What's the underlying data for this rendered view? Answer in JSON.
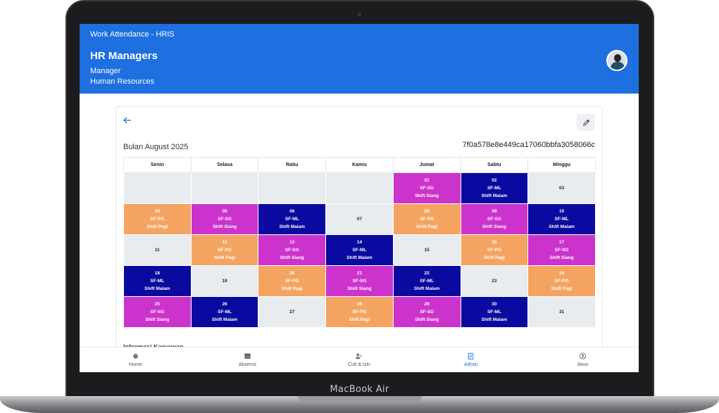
{
  "device": {
    "brand": "MacBook Air"
  },
  "header": {
    "app_title": "Work Attendance - HRIS",
    "user_name": "HR Managers",
    "user_role": "Manager",
    "user_department": "Human Resources"
  },
  "schedule": {
    "month_label": "Bulan August 2025",
    "schedule_id": "7f0a578e8e449ca17060bbfa3058066c",
    "weekdays": [
      "Senin",
      "Selasa",
      "Rabu",
      "Kamis",
      "Jumat",
      "Sabtu",
      "Minggu"
    ],
    "weeks": [
      [
        {
          "day": "",
          "code": "",
          "shift": "",
          "type": "empty"
        },
        {
          "day": "",
          "code": "",
          "shift": "",
          "type": "empty"
        },
        {
          "day": "",
          "code": "",
          "shift": "",
          "type": "empty"
        },
        {
          "day": "",
          "code": "",
          "shift": "",
          "type": "empty"
        },
        {
          "day": "01",
          "code": "SF-SG",
          "shift": "Shift Siang",
          "type": "sg"
        },
        {
          "day": "02",
          "code": "SF-ML",
          "shift": "Shift Malam",
          "type": "ml"
        },
        {
          "day": "03",
          "code": "",
          "shift": "",
          "type": "off"
        }
      ],
      [
        {
          "day": "04",
          "code": "SF-PG",
          "shift": "Shift Pagi",
          "type": "pg"
        },
        {
          "day": "05",
          "code": "SF-SG",
          "shift": "Shift Siang",
          "type": "sg"
        },
        {
          "day": "06",
          "code": "SF-ML",
          "shift": "Shift Malam",
          "type": "ml"
        },
        {
          "day": "07",
          "code": "",
          "shift": "",
          "type": "off"
        },
        {
          "day": "08",
          "code": "SF-PG",
          "shift": "Shift Pagi",
          "type": "pg"
        },
        {
          "day": "09",
          "code": "SF-SG",
          "shift": "Shift Siang",
          "type": "sg"
        },
        {
          "day": "10",
          "code": "SF-ML",
          "shift": "Shift Malam",
          "type": "ml"
        }
      ],
      [
        {
          "day": "11",
          "code": "",
          "shift": "",
          "type": "off"
        },
        {
          "day": "12",
          "code": "SF-PG",
          "shift": "Shift Pagi",
          "type": "pg"
        },
        {
          "day": "13",
          "code": "SF-SG",
          "shift": "Shift Siang",
          "type": "sg"
        },
        {
          "day": "14",
          "code": "SF-ML",
          "shift": "Shift Malam",
          "type": "ml"
        },
        {
          "day": "15",
          "code": "",
          "shift": "",
          "type": "off"
        },
        {
          "day": "16",
          "code": "SF-PG",
          "shift": "Shift Pagi",
          "type": "pg"
        },
        {
          "day": "17",
          "code": "SF-SG",
          "shift": "Shift Siang",
          "type": "sg"
        }
      ],
      [
        {
          "day": "18",
          "code": "SF-ML",
          "shift": "Shift Malam",
          "type": "ml"
        },
        {
          "day": "19",
          "code": "",
          "shift": "",
          "type": "off"
        },
        {
          "day": "20",
          "code": "SF-PG",
          "shift": "Shift Pagi",
          "type": "pg"
        },
        {
          "day": "21",
          "code": "SF-SG",
          "shift": "Shift Siang",
          "type": "sg"
        },
        {
          "day": "22",
          "code": "SF-ML",
          "shift": "Shift Malam",
          "type": "ml"
        },
        {
          "day": "23",
          "code": "",
          "shift": "",
          "type": "off"
        },
        {
          "day": "24",
          "code": "SF-PG",
          "shift": "Shift Pagi",
          "type": "pg"
        }
      ],
      [
        {
          "day": "25",
          "code": "SF-SG",
          "shift": "Shift Siang",
          "type": "sg"
        },
        {
          "day": "26",
          "code": "SF-ML",
          "shift": "Shift Malam",
          "type": "ml"
        },
        {
          "day": "27",
          "code": "",
          "shift": "",
          "type": "off"
        },
        {
          "day": "28",
          "code": "SF-PG",
          "shift": "Shift Pagi",
          "type": "pg"
        },
        {
          "day": "29",
          "code": "SF-SG",
          "shift": "Shift Siang",
          "type": "sg"
        },
        {
          "day": "30",
          "code": "SF-ML",
          "shift": "Shift Malam",
          "type": "ml"
        },
        {
          "day": "31",
          "code": "",
          "shift": "",
          "type": "off"
        }
      ]
    ],
    "cut_off_text": "Informasi Karyawan"
  },
  "nav": {
    "items": [
      {
        "label": "Home",
        "icon": "home-icon",
        "active": false
      },
      {
        "label": "Absensi",
        "icon": "calendar-icon",
        "active": false
      },
      {
        "label": "Cuti & Izin",
        "icon": "user-check-icon",
        "active": false
      },
      {
        "label": "Admin",
        "icon": "clipboard-icon",
        "active": true
      },
      {
        "label": "Akun",
        "icon": "user-circle-icon",
        "active": false
      }
    ]
  },
  "colors": {
    "primary": "#1e6fe0",
    "shift_pagi": "#f4a460",
    "shift_siang": "#cc33cc",
    "shift_malam": "#0a0aa0",
    "off_day": "#e9ecef"
  }
}
